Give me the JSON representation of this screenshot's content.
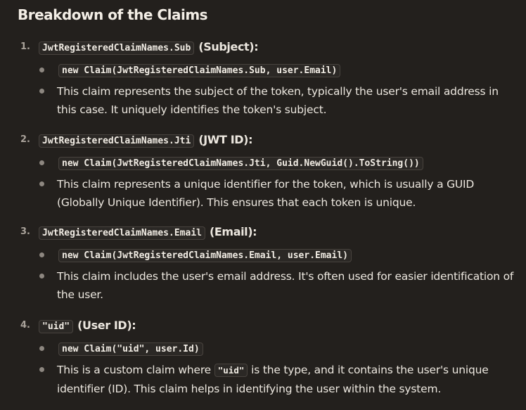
{
  "title": "Breakdown of the Claims",
  "items": [
    {
      "number": "1.",
      "code": "JwtRegisteredClaimNames.Sub",
      "label": "(Subject):",
      "snippet": "new Claim(JwtRegisteredClaimNames.Sub, user.Email)",
      "description": "This claim represents the subject of the token, typically the user's email address in this case. It uniquely identifies the token's subject."
    },
    {
      "number": "2.",
      "code": "JwtRegisteredClaimNames.Jti",
      "label": "(JWT ID):",
      "snippet": "new Claim(JwtRegisteredClaimNames.Jti, Guid.NewGuid().ToString())",
      "description": "This claim represents a unique identifier for the token, which is usually a GUID (Globally Unique Identifier). This ensures that each token is unique."
    },
    {
      "number": "3.",
      "code": "JwtRegisteredClaimNames.Email",
      "label": "(Email):",
      "snippet": "new Claim(JwtRegisteredClaimNames.Email, user.Email)",
      "description": "This claim includes the user's email address. It's often used for easier identification of the user."
    },
    {
      "number": "4.",
      "code": "\"uid\"",
      "label": "(User ID):",
      "snippet": "new Claim(\"uid\", user.Id)",
      "description_before": "This is a custom claim where",
      "description_code": "\"uid\"",
      "description_after": "is the type, and it contains the user's unique identifier (ID). This claim helps in identifying the user within the system."
    }
  ]
}
